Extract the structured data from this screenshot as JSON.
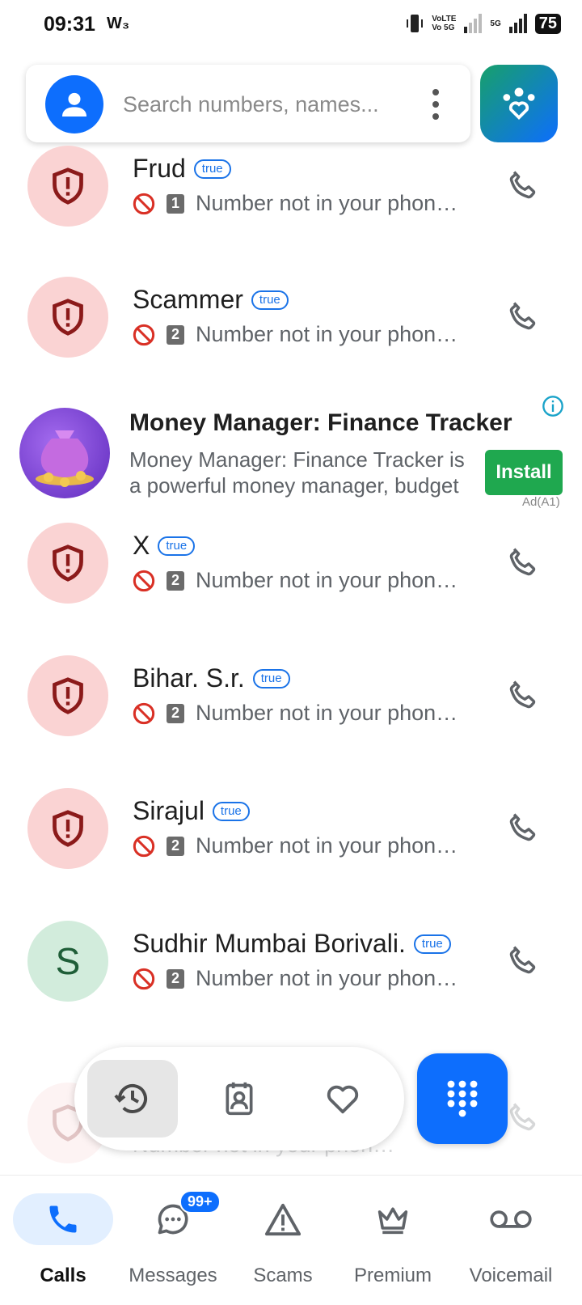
{
  "status_bar": {
    "time": "09:31",
    "left_icons": "W₃",
    "network_1": "VoLTE",
    "network_2": "Vo 5G",
    "network_3": "5G",
    "battery": "75"
  },
  "search": {
    "placeholder": "Search numbers, names..."
  },
  "calls": [
    {
      "name": "Frud",
      "badge": "true",
      "count": "1",
      "subtitle": "Number not in your phonebook"
    },
    {
      "name": "Scammer",
      "badge": "true",
      "count": "2",
      "subtitle": "Number not in your phonebook"
    },
    {
      "name": "X",
      "badge": "true",
      "count": "2",
      "subtitle": "Number not in your phonebook"
    },
    {
      "name": "Bihar. S.r.",
      "badge": "true",
      "count": "2",
      "subtitle": "Number not in your phonebook"
    },
    {
      "name": "Sirajul",
      "badge": "true",
      "count": "2",
      "subtitle": "Number not in your phonebook"
    },
    {
      "name": "Sudhir Mumbai Borivali.",
      "badge": "true",
      "count": "2",
      "subtitle": "Number not in your phonebook",
      "avatar_letter": "S"
    }
  ],
  "faded_row": {
    "subtitle": "Number not in your phonebook"
  },
  "ad": {
    "title": "Money Manager: Finance Tracker",
    "description": "Money Manager: Finance Tracker is a powerful money manager, budget tracker",
    "install_label": "Install",
    "ad_label": "Ad(A1)"
  },
  "bottom_nav": {
    "items": [
      {
        "label": "Calls",
        "icon": "phone-icon"
      },
      {
        "label": "Messages",
        "icon": "chat-icon",
        "badge": "99+"
      },
      {
        "label": "Scams",
        "icon": "warning-icon"
      },
      {
        "label": "Premium",
        "icon": "crown-icon"
      },
      {
        "label": "Voicemail",
        "icon": "voicemail-icon"
      }
    ]
  },
  "colors": {
    "accent": "#0d6efd",
    "spam_avatar_bg": "#fad3d3",
    "block_red": "#d93025",
    "install_green": "#1fa84f"
  }
}
